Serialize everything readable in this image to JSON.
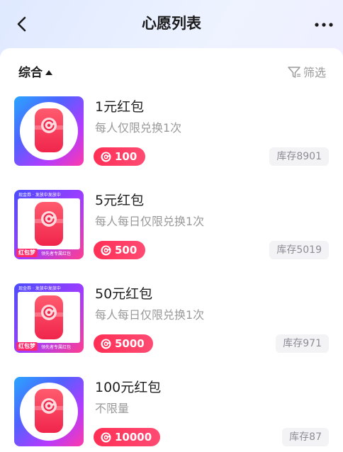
{
  "header": {
    "title": "心愿列表",
    "back_icon": "chevron-left-icon",
    "more_icon": "more-icon"
  },
  "toolbar": {
    "sort_label": "综合",
    "sort_icon": "triangle-up-icon",
    "filter_label": "筛选",
    "filter_icon": "filter-icon"
  },
  "thumb_text": {
    "tag": "红包梦",
    "topline": "现金券 · 发放中发放中",
    "note": "领先者专属红包"
  },
  "items": [
    {
      "name": "1元红包",
      "desc": "每人仅限兑换1次",
      "price": "100",
      "stock": "库存8901"
    },
    {
      "name": "5元红包",
      "desc": "每人每日仅限兑换1次",
      "price": "500",
      "stock": "库存5019"
    },
    {
      "name": "50元红包",
      "desc": "每人每日仅限兑换1次",
      "price": "5000",
      "stock": "库存971"
    },
    {
      "name": "100元红包",
      "desc": "不限量",
      "price": "10000",
      "stock": "库存87"
    }
  ],
  "colors": {
    "accent": "#ff3560",
    "stock_bg": "#f3f3f6"
  }
}
